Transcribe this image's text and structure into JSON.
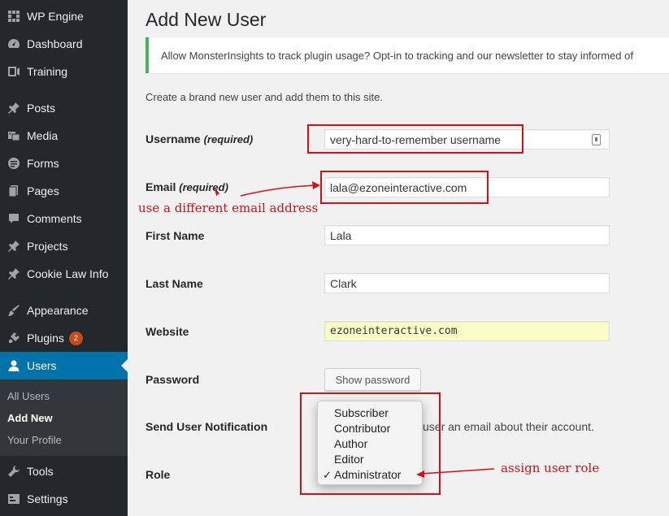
{
  "sidebar": {
    "items": [
      {
        "label": "WP Engine",
        "icon": "wp-engine-icon"
      },
      {
        "label": "Dashboard",
        "icon": "dashboard-icon"
      },
      {
        "label": "Training",
        "icon": "training-icon"
      },
      {
        "label": "Posts",
        "icon": "pin-icon"
      },
      {
        "label": "Media",
        "icon": "media-icon"
      },
      {
        "label": "Forms",
        "icon": "forms-icon"
      },
      {
        "label": "Pages",
        "icon": "pages-icon"
      },
      {
        "label": "Comments",
        "icon": "comments-icon"
      },
      {
        "label": "Projects",
        "icon": "pin-icon"
      },
      {
        "label": "Cookie Law Info",
        "icon": "pin-icon"
      },
      {
        "label": "Appearance",
        "icon": "brush-icon"
      },
      {
        "label": "Plugins",
        "icon": "plugin-icon",
        "badge": "2"
      },
      {
        "label": "Users",
        "icon": "user-icon"
      },
      {
        "label": "Tools",
        "icon": "wrench-icon"
      },
      {
        "label": "Settings",
        "icon": "settings-icon"
      }
    ],
    "submenu": [
      "All Users",
      "Add New",
      "Your Profile"
    ]
  },
  "page": {
    "title": "Add New User",
    "notice": "Allow MonsterInsights to track plugin usage? Opt-in to tracking and our newsletter to stay informed of",
    "intro": "Create a brand new user and add them to this site."
  },
  "form": {
    "username_label": "Username",
    "username_req": "(required)",
    "username_value": "very-hard-to-remember username",
    "email_label": "Email",
    "email_req": "(required)",
    "email_value": "lala@ezoneinteractive.com",
    "first_name_label": "First Name",
    "first_name_value": "Lala",
    "last_name_label": "Last Name",
    "last_name_value": "Clark",
    "website_label": "Website",
    "website_value": "ezoneinteractive.com",
    "password_label": "Password",
    "show_password": "Show password",
    "notification_label": "Send User Notification",
    "notification_text": "user an email about their account.",
    "role_label": "Role",
    "role_options": [
      "Subscriber",
      "Contributor",
      "Author",
      "Editor",
      "Administrator"
    ],
    "role_selected_mark": "✓"
  },
  "annotations": {
    "email_note": "use a different email address",
    "role_note": "assign user role"
  },
  "colors": {
    "sidebar_bg": "#23282d",
    "active_blue": "#0073aa",
    "annotation_red": "#d0111b",
    "notice_green": "#46b450"
  }
}
